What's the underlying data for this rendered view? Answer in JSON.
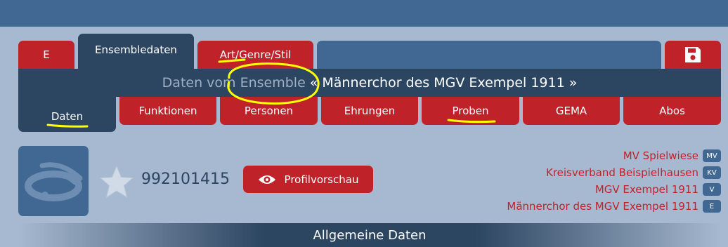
{
  "tabs": {
    "e_label": "E",
    "ensembledaten_label": "Ensembledaten",
    "art_label": "Art/Genre/Stil"
  },
  "title": {
    "prefix": "Daten vom Ensemble",
    "open_mark": "«",
    "name": "Männerchor des MGV Exempel 1911",
    "close_mark": "»"
  },
  "subtabs": [
    "Daten",
    "Funktionen",
    "Personen",
    "Ehrungen",
    "Proben",
    "GEMA",
    "Abos"
  ],
  "profile": {
    "id_number": "992101415",
    "preview_label": "Profilvorschau"
  },
  "hierarchy": [
    {
      "name": "MV Spielwiese",
      "badge": "MV"
    },
    {
      "name": "Kreisverband Beispielhausen",
      "badge": "KV"
    },
    {
      "name": "MGV Exempel 1911",
      "badge": "V"
    },
    {
      "name": "Männerchor des MGV Exempel 1911",
      "badge": "E"
    }
  ],
  "section": {
    "heading": "Allgemeine Daten"
  },
  "colors": {
    "accent_red": "#c0222a",
    "dark_navy": "#2c4561",
    "mid_blue": "#406892",
    "page_bg": "#a7b9d0",
    "highlighter": "#ffff00"
  },
  "icons": {
    "save": "floppy-disk-icon",
    "favorite": "star-icon",
    "preview": "eye-icon",
    "logo": "ensemble-logo-icon"
  }
}
